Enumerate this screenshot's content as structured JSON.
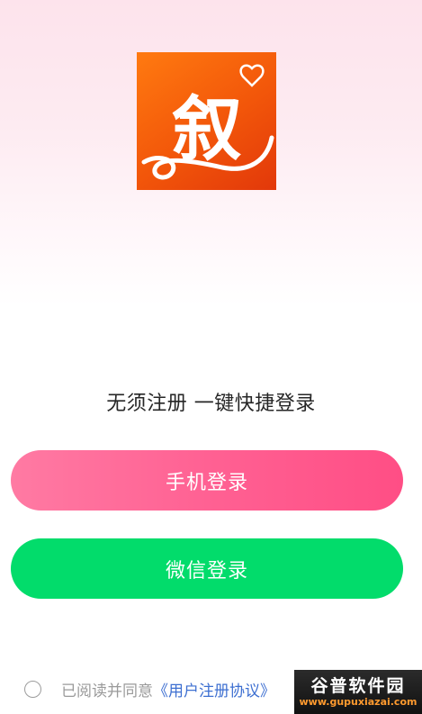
{
  "logo": {
    "glyph": "叙",
    "bg_color": "#f2560a"
  },
  "tagline": "无须注册 一键快捷登录",
  "buttons": {
    "phone_login": "手机登录",
    "wechat_login": "微信登录"
  },
  "agreement": {
    "prefix": "已阅读并同意",
    "link": "《用户注册协议》",
    "checked": false
  },
  "watermark": {
    "title": "谷普软件园",
    "url": "www.gupuxiazai.com"
  },
  "colors": {
    "phone_button": "#ff6193",
    "wechat_button": "#02dc6b",
    "link": "#3d6fd1"
  }
}
